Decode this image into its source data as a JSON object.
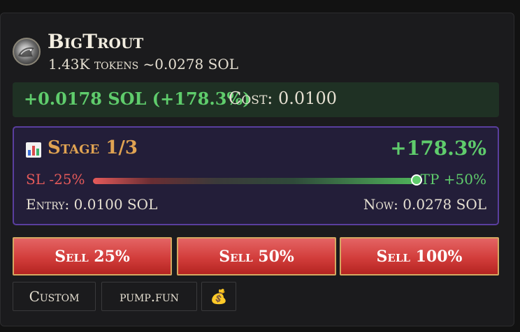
{
  "token": {
    "name": "BigTrout",
    "holdings": "1.43K tokens ~0.0278 SOL",
    "avatar_icon": "fish-icon"
  },
  "pnl": {
    "value": "+0.0178 SOL (+178.3%)",
    "cost": "Cost: 0.0100",
    "value_color": "#5fcc6c"
  },
  "stage": {
    "icon": "bar-chart-icon",
    "label": "Stage 1/3",
    "percent": "+178.3%",
    "stop_loss": "SL -25%",
    "take_profit": "TP +50%",
    "progress": 1.0,
    "entry": "Entry: 0.0100 SOL",
    "now": "Now: 0.0278 SOL",
    "accent": "#5a3e9e"
  },
  "sell_buttons": [
    {
      "label": "Sell 25%"
    },
    {
      "label": "Sell 50%"
    },
    {
      "label": "Sell 100%"
    }
  ],
  "chips": [
    {
      "label": "Custom"
    },
    {
      "label": "pump.fun"
    },
    {
      "label": "💰",
      "icon": "money-bag-icon"
    }
  ]
}
